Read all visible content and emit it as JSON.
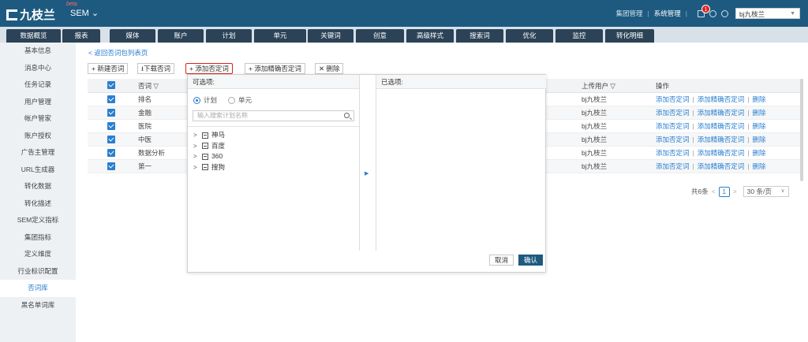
{
  "header": {
    "logo_text": "九枝兰",
    "beta": "beta",
    "product": "SEM",
    "group_mgmt": "集团管理",
    "sys_mgmt": "系统管理",
    "notif_count": "1",
    "account": "bj九枝兰"
  },
  "tabs": [
    "数据概览",
    "报表",
    "媒体",
    "账户",
    "计划",
    "单元",
    "关键词",
    "创意",
    "高级样式",
    "搜索词",
    "优化",
    "监控",
    "转化明细"
  ],
  "sidebar": [
    "基本信息",
    "消息中心",
    "任务记录",
    "用户管理",
    "帐户管家",
    "账户授权",
    "广告主管理",
    "URL生成器",
    "转化数据",
    "转化描述",
    "SEM定义指标",
    "集团指标",
    "定义维度",
    "行业标识配置",
    "否词库",
    "黑名单词库"
  ],
  "main": {
    "back_link": "< 返回否词包列表页",
    "toolbar": {
      "new": "+ 新建否词",
      "download": "下载否词",
      "add_neg": "+ 添加否定词",
      "add_exact": "+ 添加精确否定词",
      "delete": "✕ 删除"
    },
    "table": {
      "headers": {
        "word": "否词",
        "uploader": "上传用户",
        "ops": "操作"
      },
      "rows": [
        {
          "word": "排名",
          "uploader": "bj九枝兰"
        },
        {
          "word": "金融",
          "uploader": "bj九枝兰"
        },
        {
          "word": "医院",
          "uploader": "bj九枝兰"
        },
        {
          "word": "中医",
          "uploader": "bj九枝兰"
        },
        {
          "word": "数据分析",
          "uploader": "bj九枝兰"
        },
        {
          "word": "第一",
          "uploader": "bj九枝兰"
        }
      ],
      "op_add_neg": "添加否定词",
      "op_add_exact": "添加精确否定词",
      "op_delete": "删除"
    },
    "pager": {
      "total": "共6条",
      "current": "1",
      "page_size": "30 条/页"
    }
  },
  "dialog": {
    "available": "可选项:",
    "selected": "已选项:",
    "radio_plan": "计划",
    "radio_unit": "单元",
    "search_placeholder": "输入搜索计划名称",
    "tree": [
      "神马",
      "百度",
      "360",
      "搜狗"
    ],
    "cancel": "取消",
    "confirm": "确认"
  }
}
